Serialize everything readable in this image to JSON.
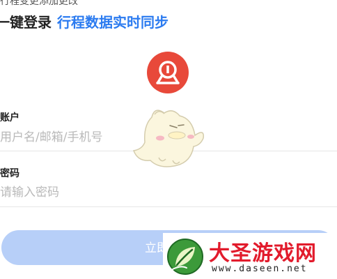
{
  "header": {
    "cut_text": "行程变更添加更改",
    "title_dark": "一键登录",
    "title_blue": "行程数据实时同步"
  },
  "logo": {
    "icon": "railway-logo-icon",
    "color": "#e8493a"
  },
  "form": {
    "account_label": "账户",
    "account_placeholder": "用户名/邮箱/手机号",
    "password_label": "密码",
    "password_placeholder": "请输入密码"
  },
  "login_button": {
    "label": "立即登录",
    "color": "#b7cff8"
  },
  "mascot": {
    "icon": "chick-mascot-icon"
  },
  "watermark": {
    "title": "大圣游戏网",
    "url": "www.daseen.net",
    "icon": "leaf-logo-icon",
    "title_color": "#e21b2c"
  },
  "colors": {
    "accent_blue": "#2b7bf0",
    "text_dark": "#222222",
    "placeholder": "#b9b9b9",
    "divider": "#e6e6e6"
  }
}
